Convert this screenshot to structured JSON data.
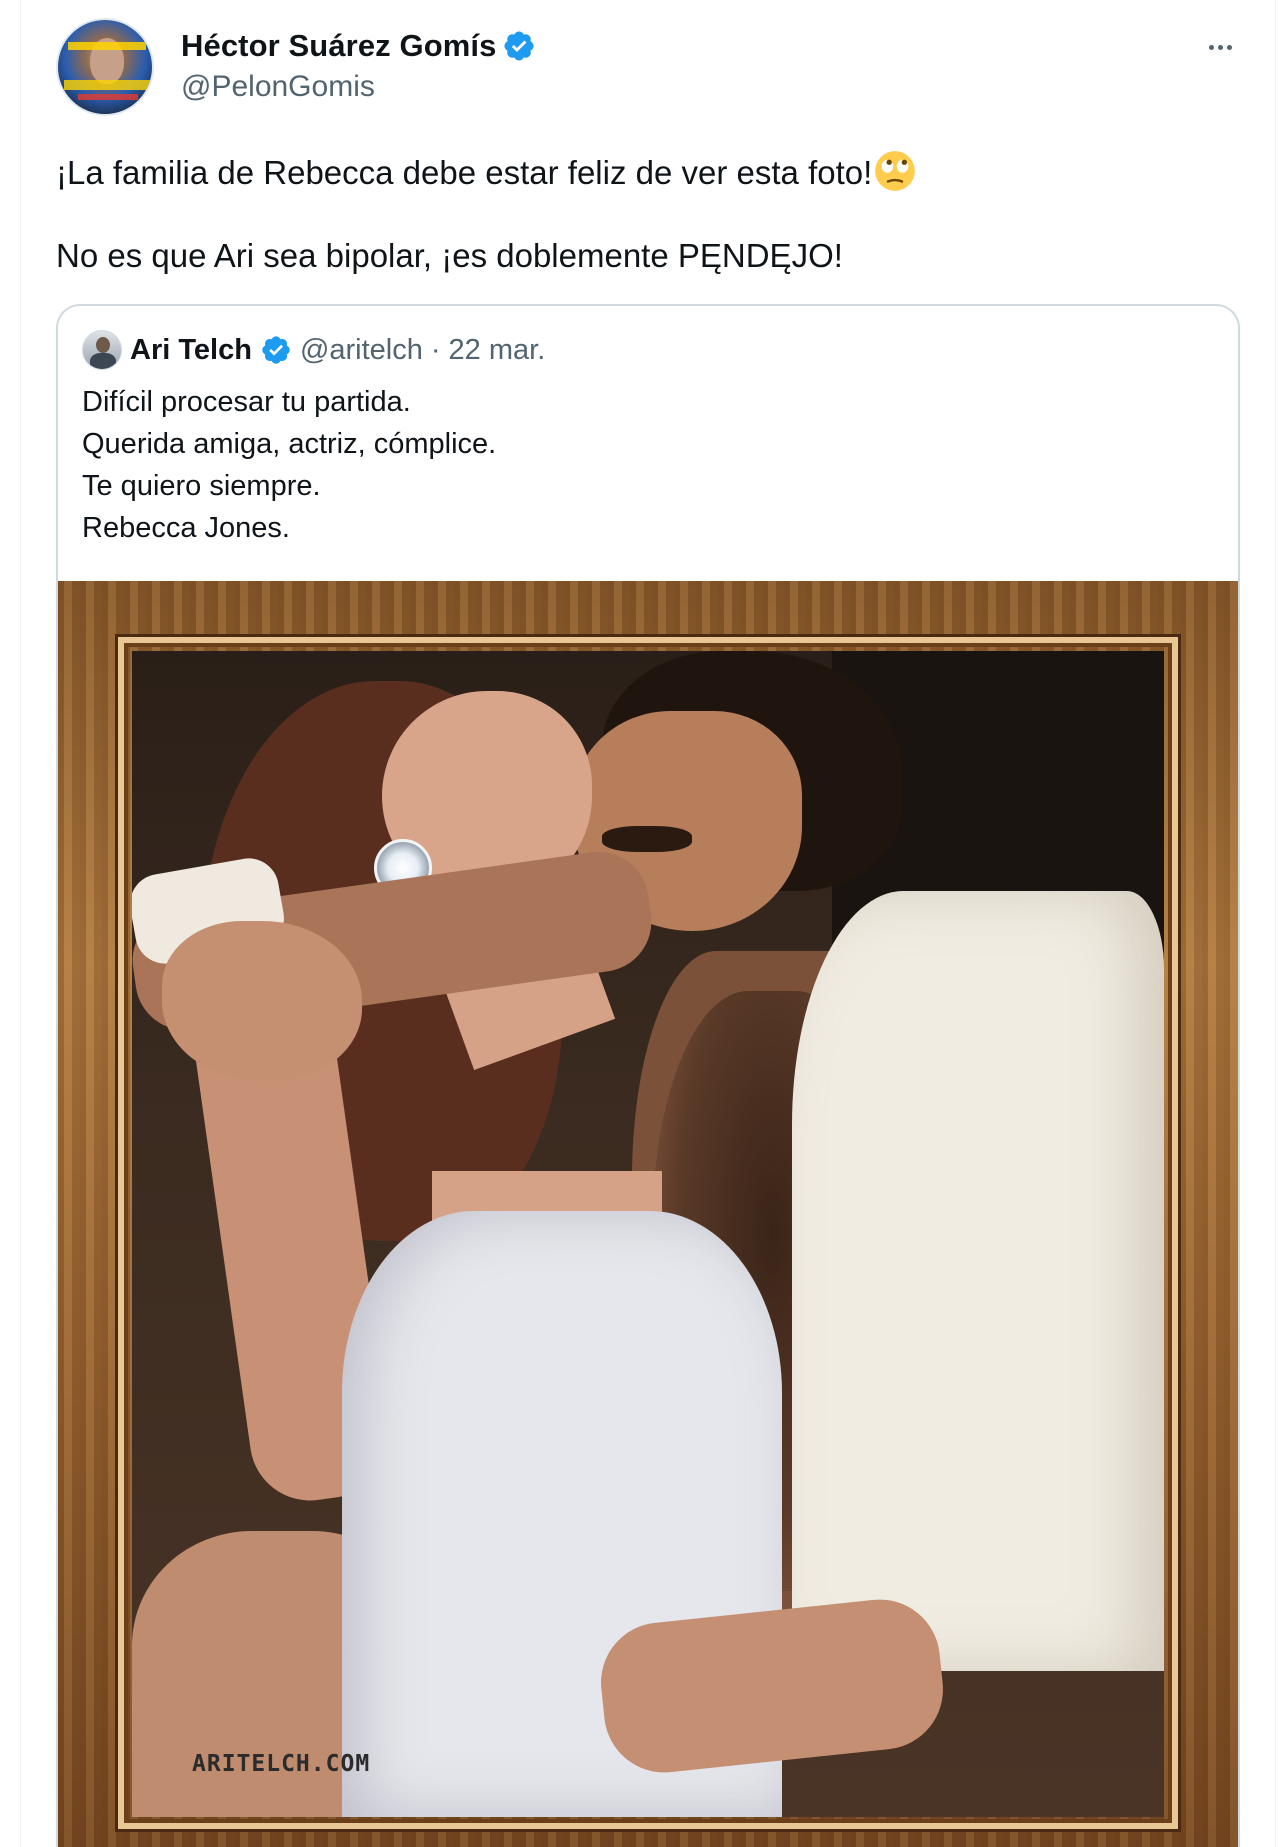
{
  "tweet": {
    "author": {
      "display_name": "Héctor Suárez Gomís",
      "handle": "@PelonGomis",
      "verified": true
    },
    "more_icon": "ellipsis-icon",
    "text_line1": "¡La familia de Rebecca debe estar feliz de ver esta foto!",
    "emoji_icon": "face-with-rolling-eyes-emoji",
    "text_line2": "No es que Ari sea bipolar, ¡es doblemente PĘNDĘJO!"
  },
  "quote": {
    "display_name": "Ari Telch",
    "handle": "@aritelch",
    "separator": "·",
    "date": "22 mar.",
    "verified": true,
    "lines": [
      "Difícil procesar tu partida.",
      "Querida amiga, actriz, cómplice.",
      "Te quiero siempre.",
      "Rebecca Jones."
    ],
    "media": {
      "watermark": "ARITELCH.COM"
    }
  },
  "colors": {
    "verified_blue": "#1d9bf0",
    "text_primary": "#0f1419",
    "text_secondary": "#536471",
    "border": "#cfd9de"
  }
}
